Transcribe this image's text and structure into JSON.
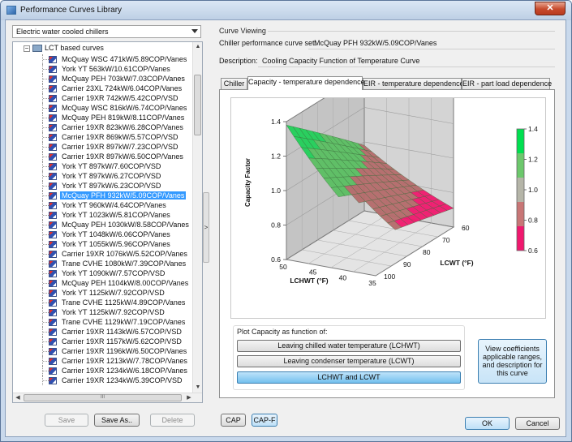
{
  "window": {
    "title": "Performance Curves Library",
    "close_label": "✕"
  },
  "left": {
    "category_selected": "Electric water cooled chillers",
    "tree_root_expander": "−",
    "tree_root": "LCT based curves",
    "items": [
      "McQuay WSC 471kW/5.89COP/Vanes",
      "York YT 563kW/10.61COP/Vanes",
      "McQuay PEH 703kW/7.03COP/Vanes",
      "Carrier 23XL 724kW/6.04COP/Vanes",
      "Carrier 19XR 742kW/5.42COP/VSD",
      "McQuay WSC 816kW/6.74COP/Vanes",
      "McQuay PEH 819kW/8.11COP/Vanes",
      "Carrier 19XR 823kW/6.28COP/Vanes",
      "Carrier 19XR 869kW/5.57COP/VSD",
      "Carrier 19XR 897kW/7.23COP/VSD",
      "Carrier 19XR 897kW/6.50COP/Vanes",
      "York YT 897kW/7.60COP/VSD",
      "York YT 897kW/6.27COP/VSD",
      "York YT 897kW/6.23COP/VSD",
      "McQuay PFH 932kW/5.09COP/Vanes",
      "York YT 960kW/4.64COP/Vanes",
      "York YT 1023kW/5.81COP/Vanes",
      "McQuay PEH 1030kW/8.58COP/Vanes",
      "York YT 1048kW/6.06COP/Vanes",
      "York YT 1055kW/5.96COP/Vanes",
      "Carrier 19XR 1076kW/5.52COP/Vanes",
      "Trane CVHE 1080kW/7.39COP/Vanes",
      "York YT 1090kW/7.57COP/VSD",
      "McQuay PEH 1104kW/8.00COP/Vanes",
      "York YT 1125kW/7.92COP/VSD",
      "Trane CVHE 1125kW/4.89COP/Vanes",
      "York YT 1125kW/7.92COP/VSD",
      "Trane CVHE 1129kW/7.19COP/Vanes",
      "Carrier 19XR 1143kW/6.57COP/VSD",
      "Carrier 19XR 1157kW/5.62COP/VSD",
      "Carrier 19XR 1196kW/6.50COP/Vanes",
      "Carrier 19XR 1213kW/7.78COP/Vanes",
      "Carrier 19XR 1234kW/6.18COP/Vanes",
      "Carrier 19XR 1234kW/5.39COP/VSD"
    ],
    "selected_index": 14,
    "scroll_up": "▲",
    "scroll_down": "▼",
    "scroll_left": "◀",
    "scroll_right": "▶",
    "scroll_grip": "III",
    "save_label": "Save",
    "save_as_label": "Save As..",
    "delete_label": "Delete",
    "splitter_label": ">"
  },
  "right": {
    "section": "Curve Viewing",
    "set_label": "Chiller performance curve set:",
    "set_value": "McQuay PFH 932kW/5.09COP/Vanes",
    "desc_label": "Description:",
    "desc_value": "Cooling Capacity Function of Temperature Curve",
    "tabs": [
      "Chiller",
      "Capacity - temperature dependence",
      "EIR - temperature dependence",
      "EIR - part load dependence"
    ],
    "active_tab": 1,
    "group_title": "Plot Capacity as function of:",
    "plot_buttons": [
      "Leaving chilled water temperature (LCHWT)",
      "Leaving condenser temperature (LCWT)",
      "LCHWT and LCWT"
    ],
    "active_plot_button": 2,
    "info_button": "View coefficients applicable ranges, and description for this curve",
    "cap_label": "CAP",
    "capf_label": "CAP-F",
    "ok_label": "OK",
    "cancel_label": "Cancel"
  },
  "chart_data": {
    "type": "surface3d",
    "zlabel": "Capacity Factor",
    "xlabel": "LCHWT (°F)",
    "ylabel": "LCWT (°F)",
    "z_ticks": [
      "0.6",
      "0.8",
      "1.0",
      "1.2",
      "1.4"
    ],
    "x_ticks": [
      "50",
      "45",
      "40",
      "35"
    ],
    "y_ticks": [
      "60",
      "70",
      "80",
      "90",
      "100"
    ],
    "colorbar_ticks": [
      "1.4",
      "1.2",
      "1.0",
      "0.8",
      "0.6"
    ],
    "colorbar_colors": [
      "#00e050",
      "#6cc86c",
      "#b5b5a8",
      "#c87676",
      "#f0186e"
    ]
  }
}
